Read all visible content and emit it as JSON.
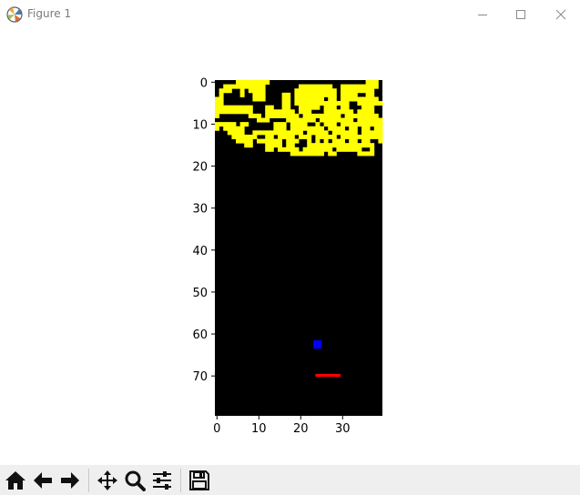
{
  "window": {
    "title": "Figure 1",
    "icons": {
      "app": "matplotlib-logo-icon",
      "minimize": "minimize-icon",
      "maximize": "maximize-icon",
      "close": "close-icon"
    }
  },
  "toolbar": {
    "buttons": [
      {
        "name": "home",
        "icon": "home-icon"
      },
      {
        "name": "back",
        "icon": "arrow-left-icon"
      },
      {
        "name": "forward",
        "icon": "arrow-right-icon"
      },
      {
        "name": "pan",
        "icon": "move-icon"
      },
      {
        "name": "zoom",
        "icon": "zoom-icon"
      },
      {
        "name": "configure-subplots",
        "icon": "sliders-icon"
      },
      {
        "name": "save",
        "icon": "floppy-disk-icon"
      }
    ]
  },
  "chart_data": {
    "type": "heatmap",
    "title": "",
    "xlabel": "",
    "ylabel": "",
    "xlim": [
      -0.5,
      39.5
    ],
    "ylim": [
      79.5,
      -0.5
    ],
    "x_ticks": [
      0,
      10,
      20,
      30
    ],
    "y_ticks": [
      0,
      10,
      20,
      30,
      40,
      50,
      60,
      70
    ],
    "grid": false,
    "background_color": "#000000",
    "colors": {
      "brick": "#ffff00",
      "ball": "#0000ff",
      "paddle": "#ff0000",
      "empty": "#000000"
    },
    "brick_rows": [
      "0000011111111000000000000000000000001110",
      "0011111111110000000011111111001111111110",
      "0111001011110000000111111111101111111100",
      "0100001001110000110111111111101111001100",
      "1100000001110000110111111101101111111110",
      "1100000000000000110111111111111100111111",
      "1111111110001100110011111011101100011100",
      "1111111110001111111011100011111110111100",
      "1000000011101111111101111111110111111110",
      "0000000000111000011111110111111110111111",
      "1111101100000011101111001011101111111111",
      "1011111000000011101111111101111011011011",
      "0001111001111111111110111110111111011111",
      "0000111111001101111011101111101111111111",
      "0000011110111111011100101010111011011001",
      "0000000110001111011000111111111111111100",
      "0000000000001101111101111111011111100100",
      "0000000000000000001111111101100000111100"
    ],
    "brick_rows_range": [
      0,
      17
    ],
    "ball": {
      "x": 23.5,
      "y": 62
    },
    "paddle": {
      "x_start": 24,
      "x_end": 29,
      "y": 70
    }
  }
}
